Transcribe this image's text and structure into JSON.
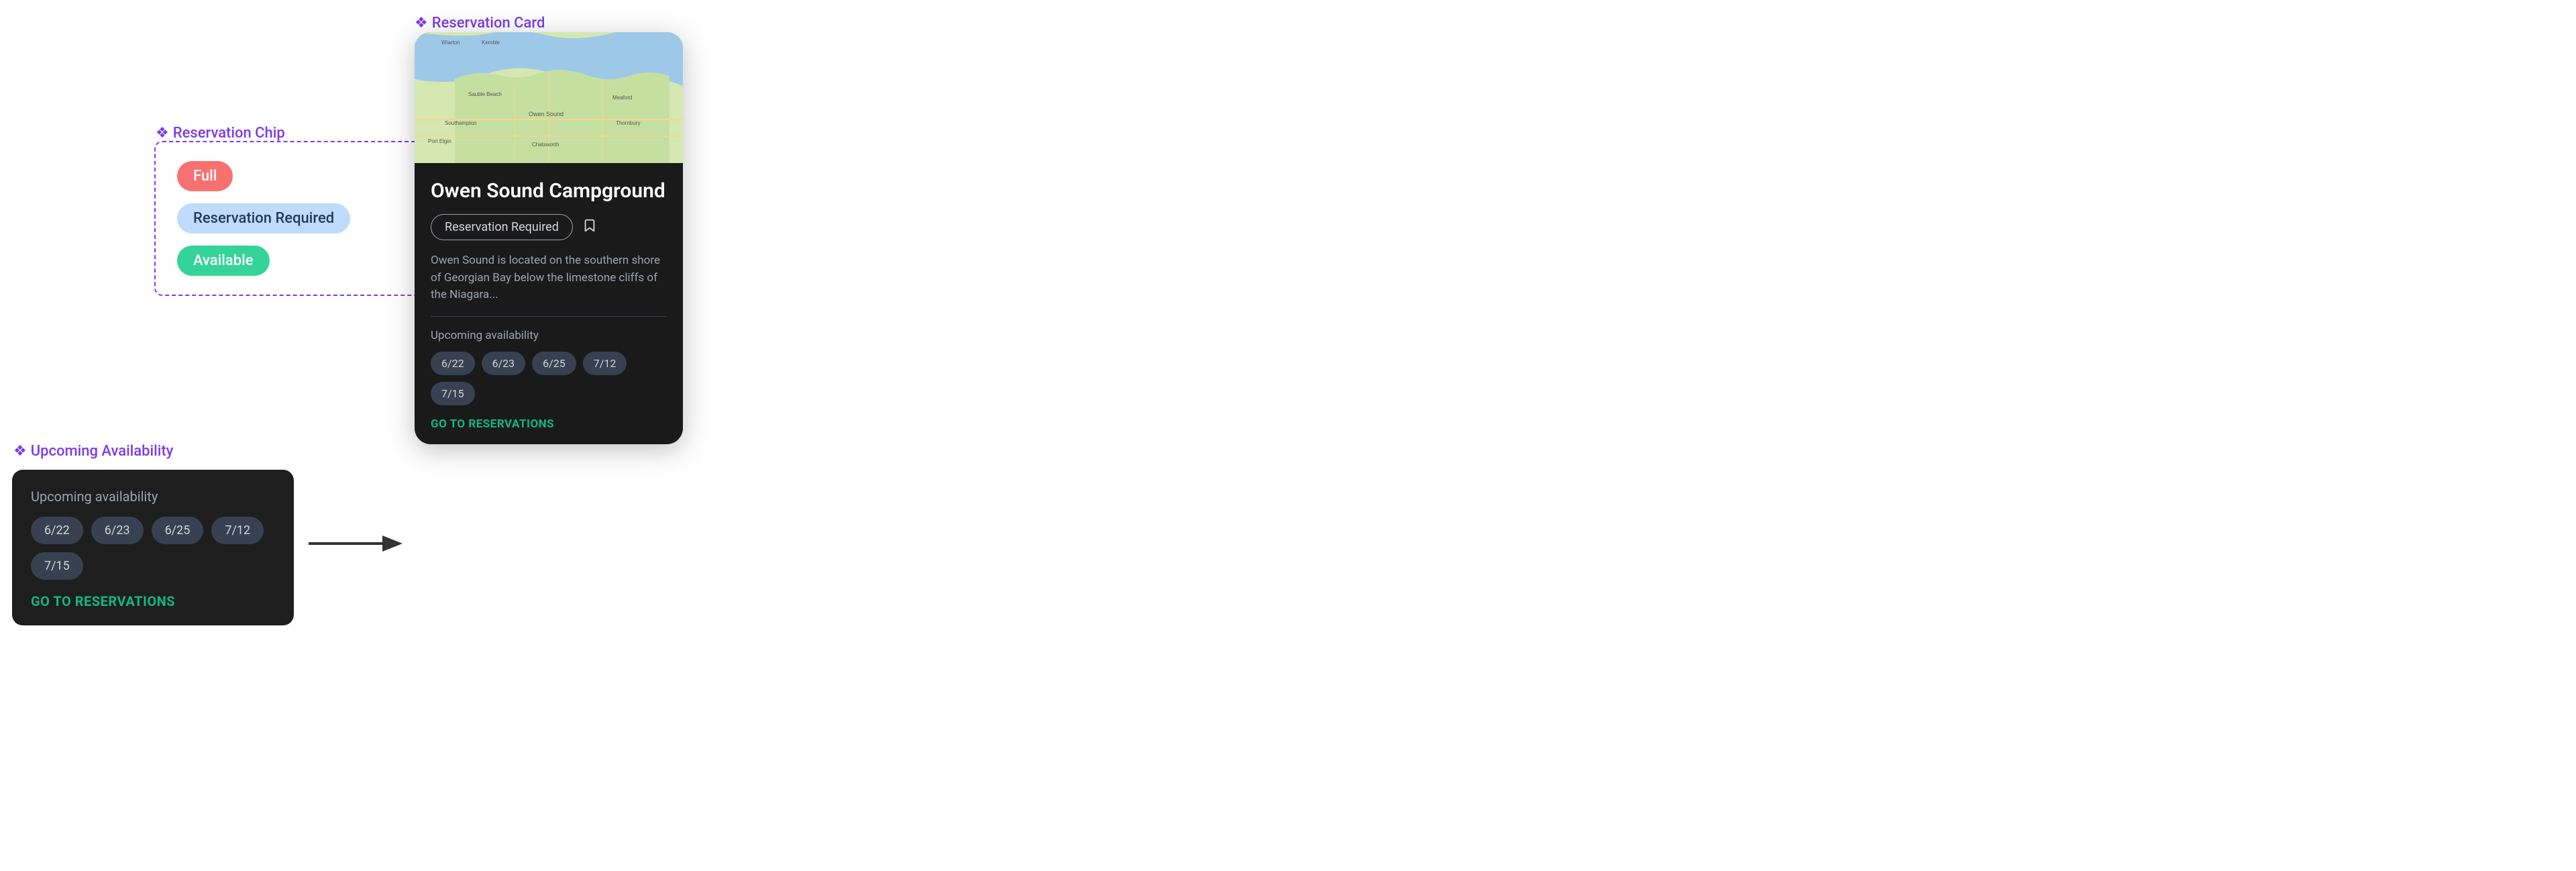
{
  "chipSection": {
    "label": "Reservation Chip",
    "chips": {
      "full": "Full",
      "reservationRequired": "Reservation Required",
      "available": "Available"
    }
  },
  "upcomingSection": {
    "label": "Upcoming Availability",
    "title": "Upcoming availability",
    "dates": [
      "6/22",
      "6/23",
      "6/25",
      "7/12",
      "7/15"
    ],
    "goButton": "GO TO RESERVATIONS"
  },
  "cardSection": {
    "label": "Reservation Card",
    "title": "Owen Sound Campground",
    "reservationChip": "Reservation Required",
    "description": "Owen Sound is located on the southern shore of Georgian Bay below the limestone cliffs of the Niagara...",
    "upcomingTitle": "Upcoming availability",
    "dates": [
      "6/22",
      "6/23",
      "6/25",
      "7/12",
      "7/15"
    ],
    "goButton": "GO TO RESERVATIONS"
  },
  "icons": {
    "diamond": "❖",
    "bookmark": "🔖",
    "arrowRight": "→"
  }
}
